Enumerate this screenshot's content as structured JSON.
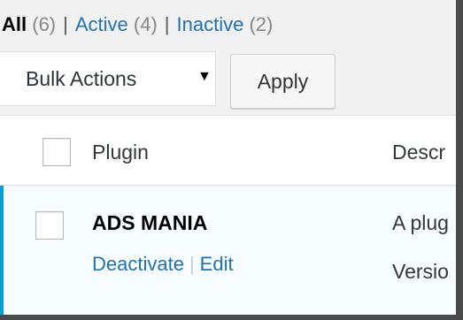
{
  "filters": {
    "all_label": "All",
    "all_count": "(6)",
    "separator": "|",
    "active_label": "Active",
    "active_count": "(4)",
    "inactive_label": "Inactive",
    "inactive_count": "(2)"
  },
  "bulk_actions": {
    "selected": "Bulk Actions",
    "caret": "▼",
    "apply_label": "Apply"
  },
  "table": {
    "columns": [
      "Plugin",
      "Descr"
    ],
    "rows": [
      {
        "name": "ADS MANIA",
        "actions": [
          "Deactivate",
          "Edit"
        ],
        "action_separator": "|",
        "description_line1": "A plug",
        "description_line2": "Versio"
      }
    ]
  },
  "colors": {
    "accent": "#00a0d2",
    "link": "#2271b1",
    "active_row_bg": "#f7fcfe"
  }
}
